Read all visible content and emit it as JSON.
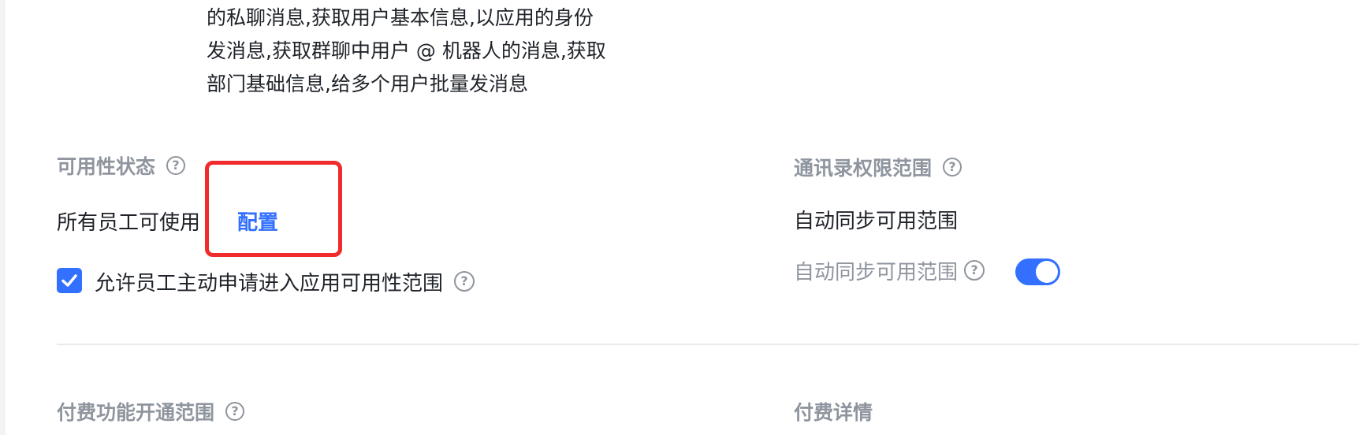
{
  "permissions": {
    "desc_lines": [
      "的私聊消息,获取用户基本信息,以应用的身份",
      "发消息,获取群聊中用户 @ 机器人的消息,获取",
      "部门基础信息,给多个用户批量发消息"
    ]
  },
  "availability": {
    "title": "可用性状态",
    "status": "所有员工可使用",
    "configure_label": "配置",
    "checkbox_label": "允许员工主动申请进入应用可用性范围",
    "checkbox_checked": true
  },
  "contacts_scope": {
    "title": "通讯录权限范围",
    "value": "自动同步可用范围",
    "toggle_label": "自动同步可用范围",
    "toggle_on": true
  },
  "paid_scope": {
    "title": "付费功能开通范围"
  },
  "paid_details": {
    "title": "付费详情"
  },
  "icons": {
    "help": "?"
  },
  "colors": {
    "accent": "#3370ff",
    "highlight": "#f02b2b",
    "muted": "#8f959e"
  }
}
